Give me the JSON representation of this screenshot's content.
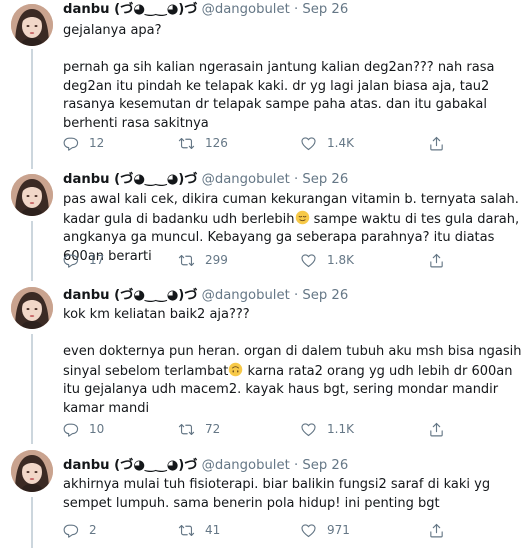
{
  "author": {
    "name": "danbu (づ◕‿‿◕)づ",
    "handle": "@dangobulet",
    "separator": "·"
  },
  "tweets": [
    {
      "time": "Sep 26",
      "text": "gejalanya apa?\n\npernah ga sih kalian ngerasain jantung kalian deg2an??? nah rasa deg2an itu pindah ke telapak kaki. dr yg lagi jalan biasa aja, tau2 rasanya kesemutan dr telapak sampe paha atas. dan itu gabakal berhenti rasa sakitnya",
      "replies": "12",
      "retweets": "126",
      "likes": "1.4K"
    },
    {
      "time": "Sep 26",
      "text_before_emoji": "pas awal kali cek, dikira cuman kekurangan vitamin b. ternyata salah. kadar gula di badanku udh berlebih",
      "emoji": "relieved-face",
      "text_after_emoji": " sampe waktu di tes gula darah, angkanya ga muncul. Kebayang ga seberapa parahnya? itu diatas 600an berarti",
      "replies": "17",
      "retweets": "299",
      "likes": "1.8K"
    },
    {
      "time": "Sep 26",
      "text_before_emoji": "kok km keliatan baik2 aja???\n\neven dokternya pun heran. organ di dalem tubuh aku msh bisa ngasih sinyal sebelom terlambat",
      "emoji": "upside-down-face",
      "text_after_emoji": " karna rata2 orang yg udh lebih dr 600an itu gejalanya udh macem2. kayak haus bgt, sering mondar mandir kamar mandi",
      "replies": "10",
      "retweets": "72",
      "likes": "1.1K"
    },
    {
      "time": "Sep 26",
      "text": "akhirnya mulai tuh fisioterapi. biar balikin fungsi2 saraf di kaki yg sempet lumpuh. sama benerin pola hidup! ini penting bgt",
      "replies": "2",
      "retweets": "41",
      "likes": "971"
    }
  ],
  "icons": {
    "reply": "reply-icon",
    "retweet": "retweet-icon",
    "like": "heart-icon",
    "share": "share-icon"
  },
  "colors": {
    "text": "#14171a",
    "secondary": "#657786",
    "thread_line": "#ccd6dd"
  }
}
